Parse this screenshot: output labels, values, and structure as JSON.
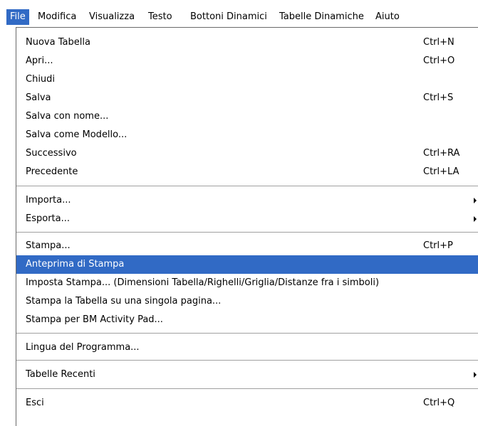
{
  "menubar": {
    "items": [
      {
        "label": "File",
        "active": true
      },
      {
        "label": "Modifica"
      },
      {
        "label": "Visualizza"
      },
      {
        "label": "Testo"
      },
      {
        "label": "Bottoni Dinamici"
      },
      {
        "label": "Tabelle Dinamiche"
      },
      {
        "label": "Aiuto"
      }
    ]
  },
  "file_menu": {
    "items": [
      {
        "label": "Nuova Tabella",
        "shortcut": "Ctrl+N"
      },
      {
        "label": "Apri...",
        "shortcut": "Ctrl+O"
      },
      {
        "label": "Chiudi"
      },
      {
        "label": "Salva",
        "shortcut": "Ctrl+S"
      },
      {
        "label": "Salva con nome..."
      },
      {
        "label": "Salva come Modello..."
      },
      {
        "label": "Successivo",
        "shortcut": "Ctrl+RA"
      },
      {
        "label": "Precedente",
        "shortcut": "Ctrl+LA"
      },
      {
        "label": "Importa...",
        "submenu": true
      },
      {
        "label": "Esporta...",
        "submenu": true
      },
      {
        "label": "Stampa...",
        "shortcut": "Ctrl+P"
      },
      {
        "label": "Anteprima di Stampa",
        "highlighted": true
      },
      {
        "label": "Imposta Stampa... (Dimensioni Tabella/Righelli/Griglia/Distanze fra i simboli)"
      },
      {
        "label": "Stampa la Tabella su una singola pagina..."
      },
      {
        "label": "Stampa per BM Activity Pad..."
      },
      {
        "label": "Lingua del Programma..."
      },
      {
        "label": "Tabelle Recenti",
        "submenu": true
      },
      {
        "label": "Esci",
        "shortcut": "Ctrl+Q"
      }
    ]
  },
  "colors": {
    "highlight": "#316ac5",
    "highlight_text": "#ffffff",
    "separator": "#a0a0a0"
  }
}
